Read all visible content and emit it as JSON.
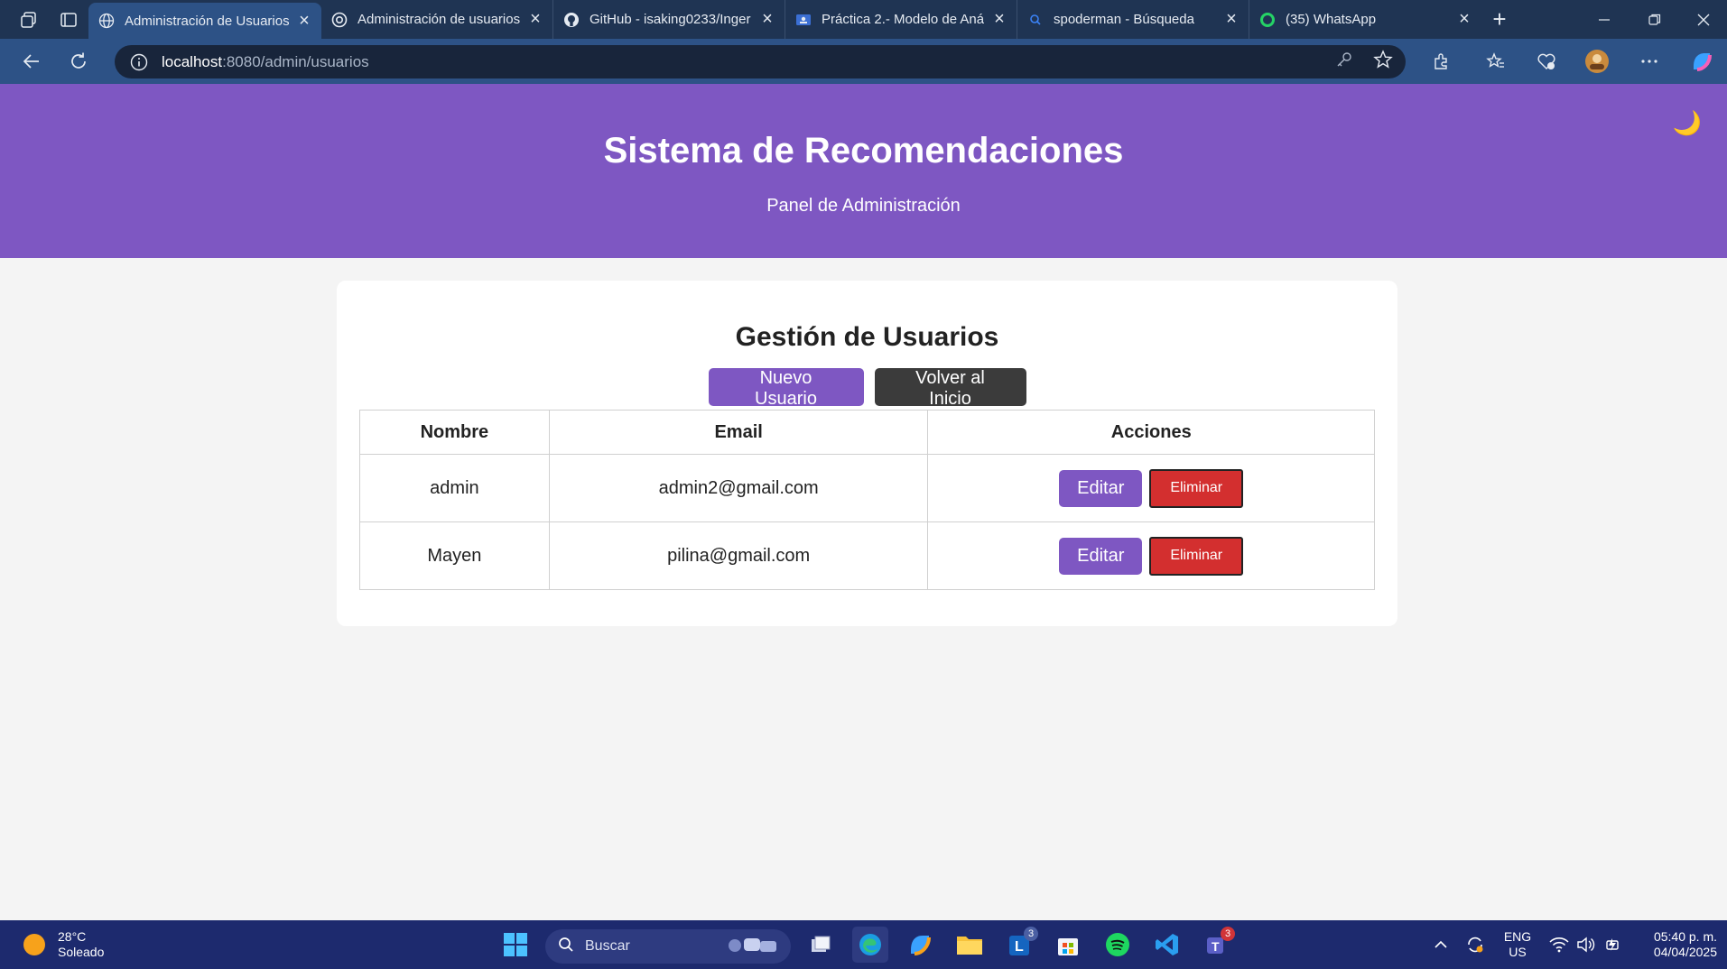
{
  "browser": {
    "tabs": [
      {
        "title": "Administración de Usuarios",
        "active": true,
        "icon": "globe-icon"
      },
      {
        "title": "Administración de usuarios",
        "active": false,
        "icon": "openai-icon"
      },
      {
        "title": "GitHub - isaking0233/Inger",
        "active": false,
        "icon": "github-icon"
      },
      {
        "title": "Práctica 2.- Modelo de Aná",
        "active": false,
        "icon": "classroom-icon"
      },
      {
        "title": "spoderman - Búsqueda",
        "active": false,
        "icon": "bing-search-icon"
      },
      {
        "title": "(35) WhatsApp",
        "active": false,
        "icon": "whatsapp-icon"
      }
    ],
    "url_host": "localhost",
    "url_path": ":8080/admin/usuarios"
  },
  "header": {
    "title": "Sistema de Recomendaciones",
    "subtitle": "Panel de Administración",
    "theme_toggle": "🌙"
  },
  "main": {
    "heading": "Gestión de Usuarios",
    "new_user_label": "Nuevo Usuario",
    "back_label": "Volver al Inicio",
    "table": {
      "columns": [
        "Nombre",
        "Email",
        "Acciones"
      ],
      "rows": [
        {
          "name": "admin",
          "email": "admin2@gmail.com",
          "edit": "Editar",
          "delete": "Eliminar"
        },
        {
          "name": "Mayen",
          "email": "pilina@gmail.com",
          "edit": "Editar",
          "delete": "Eliminar"
        }
      ]
    }
  },
  "taskbar": {
    "temperature": "28°C",
    "condition": "Soleado",
    "search_placeholder": "Buscar",
    "badges": {
      "outlook": "3",
      "teams": "3"
    },
    "language": "ENG",
    "region": "US",
    "time": "05:40 p. m.",
    "date": "04/04/2025"
  },
  "colors": {
    "accent": "#7e57c2",
    "danger": "#d32f2f",
    "dark_button": "#3b3b3b",
    "chrome": "#1f3453",
    "taskbar": "#1d2a6e"
  }
}
